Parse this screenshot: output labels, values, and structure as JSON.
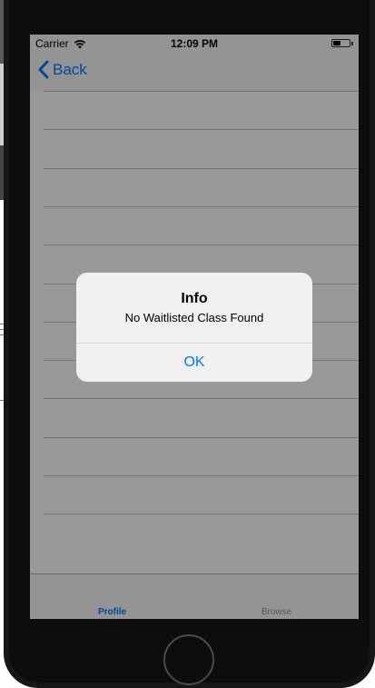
{
  "status_bar": {
    "carrier": "Carrier",
    "time": "12:09 PM",
    "battery_level": 0.45,
    "wifi_icon": "wifi-icon",
    "battery_icon": "battery-icon"
  },
  "nav_bar": {
    "back_label": "Back",
    "back_icon": "chevron-left-icon"
  },
  "table": {
    "row_count": 12
  },
  "alert": {
    "title": "Info",
    "message": "No Waitlisted Class Found",
    "ok_label": "OK"
  },
  "tab_bar": {
    "items": [
      {
        "label": "Profile",
        "selected": true
      },
      {
        "label": "Browse",
        "selected": false
      }
    ]
  },
  "colors": {
    "accent": "#007aff",
    "tab_inactive": "#929292",
    "device_frame": "#161617",
    "dim_overlay": "rgba(0,0,0,0.4)"
  }
}
